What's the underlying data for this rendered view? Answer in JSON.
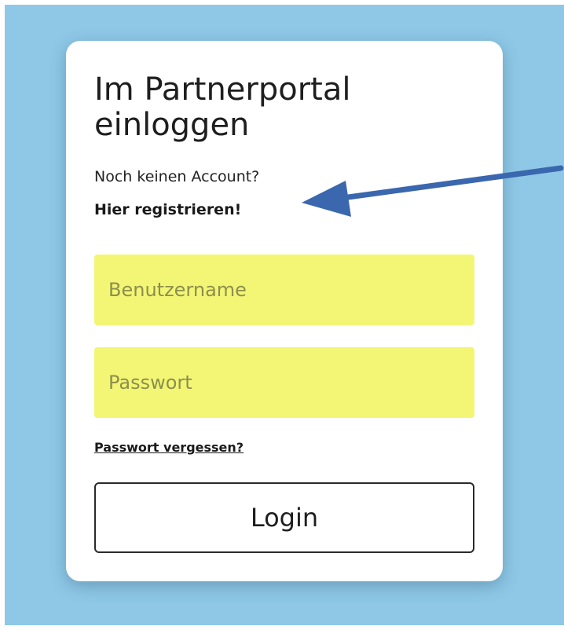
{
  "login_card": {
    "title": "Im Partnerportal einloggen",
    "no_account_text": "Noch keinen Account?",
    "register_link": "Hier registrieren!",
    "username_placeholder": "Benutzername",
    "password_placeholder": "Passwort",
    "forgot_password_link": "Passwort vergessen?",
    "login_button_label": "Login"
  },
  "colors": {
    "background": "#8ec8e6",
    "input_background": "#f3f674",
    "annotation_arrow": "#3a67ae"
  },
  "annotation": {
    "icon": "arrow-icon",
    "points_to": "register-link"
  }
}
